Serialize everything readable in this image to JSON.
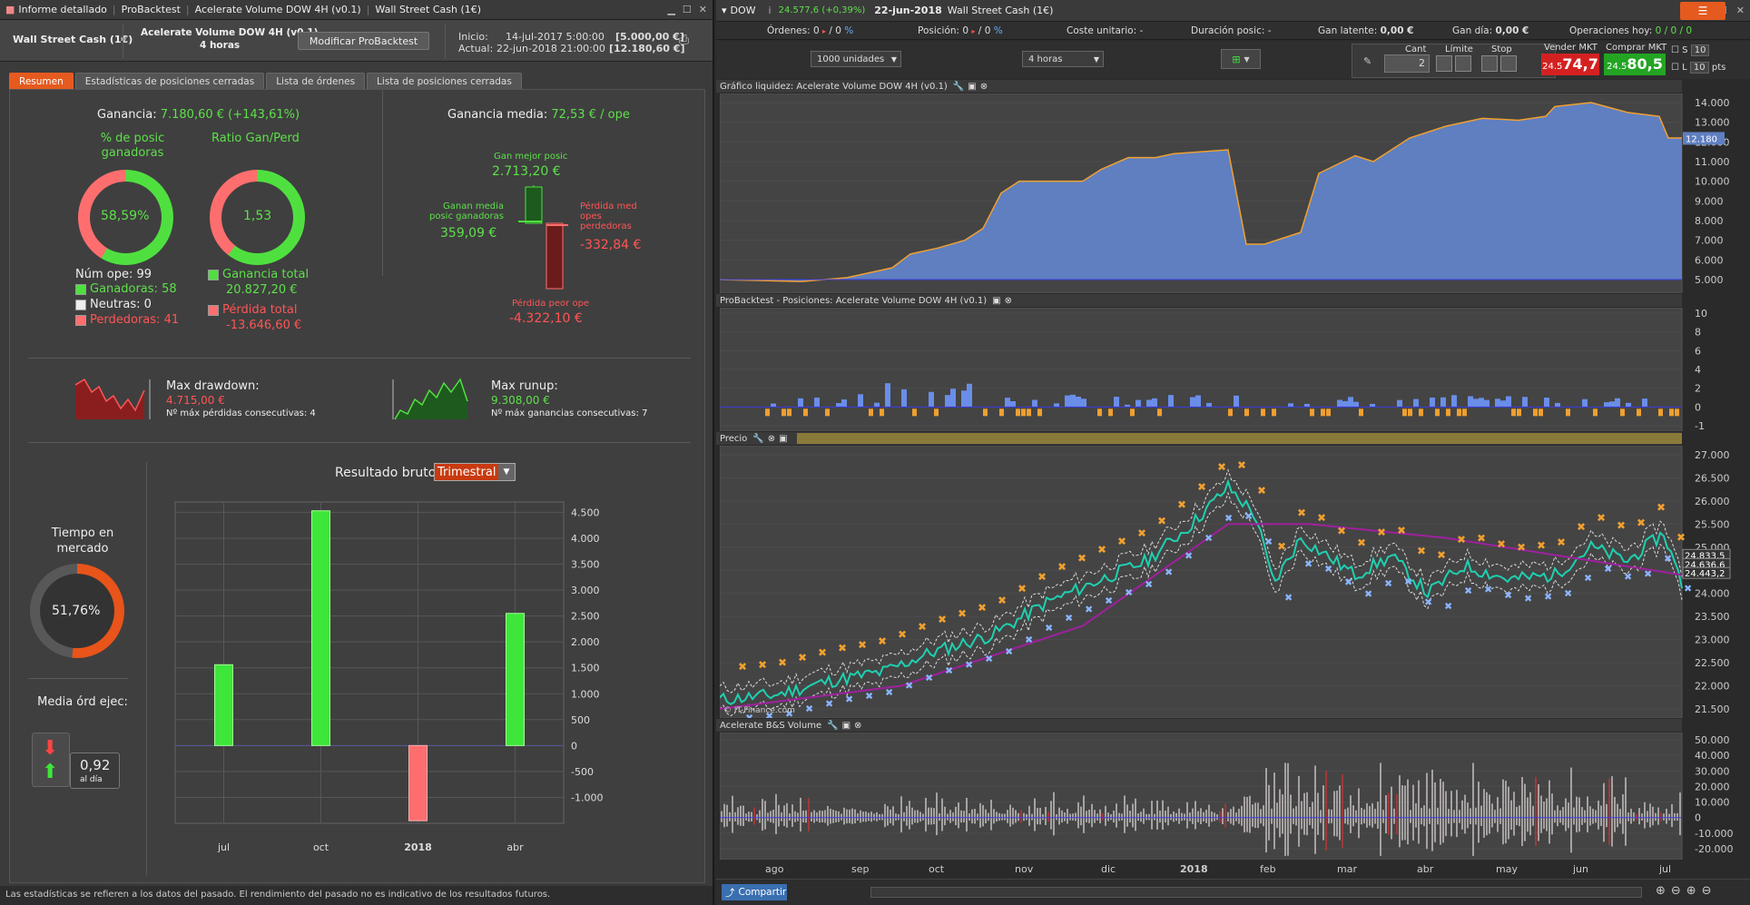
{
  "left_title": {
    "items": [
      "Informe detallado",
      "ProBacktest",
      "Acelerate Volume DOW 4H (v0.1)",
      "Wall Street Cash (1€)"
    ]
  },
  "header": {
    "instrument": "Wall Street Cash (1€)",
    "strategy": "Acelerate Volume DOW 4H (v0.1)",
    "timeframe": "4 horas",
    "modify_button": "Modificar ProBacktest",
    "start_label": "Inicio:",
    "start_date": "14-jul-2017 5:00:00",
    "start_capital": "[5.000,00 €]",
    "end_label": "Actual:",
    "end_date": "22-jun-2018 21:00:00",
    "end_capital": "[12.180,60 €]"
  },
  "tabs": [
    "Resumen",
    "Estadísticas de posiciones cerradas",
    "Lista de órdenes",
    "Lista de posiciones cerradas"
  ],
  "summary": {
    "gain_label": "Ganancia:",
    "gain_value": "7.180,60 € (+143,61%)",
    "winners_pct_label": "% de posic ganadoras",
    "winners_pct": "58,59%",
    "ratio_label": "Ratio Gan/Perd",
    "ratio": "1,53",
    "num_ops_label": "Núm ope:",
    "num_ops": "99",
    "winners_label": "Ganadoras:",
    "winners": "58",
    "neutral_label": "Neutras:",
    "neutral": "0",
    "losers_label": "Perdedoras:",
    "losers": "41",
    "total_gain_label": "Ganancia total",
    "total_gain": "20.827,20 €",
    "total_loss_label": "Pérdida total",
    "total_loss": "-13.646,60 €",
    "avg_gain_label": "Ganancia media:",
    "avg_gain": "72,53 € / ope",
    "best_label": "Gan mejor posic",
    "best": "2.713,20 €",
    "avg_win_label": "Ganan media posic ganadoras",
    "avg_win": "359,09 €",
    "avg_loss_label": "Pérdida med opes perdedoras",
    "avg_loss": "-332,84 €",
    "worst_label": "Pérdida peor ope",
    "worst": "-4.322,10 €",
    "dd_label": "Max drawdown:",
    "dd_value": "4.715,00 €",
    "dd_note": "Nº máx pérdidas consecutivas: 4",
    "ru_label": "Max runup:",
    "ru_value": "9.308,00 €",
    "ru_note": "Nº máx ganancias consecutivas: 7",
    "time_label": "Tiempo en mercado",
    "time_value": "51,76%",
    "avg_orders_label": "Media órd ejec:",
    "avg_orders": "0,92",
    "avg_orders_unit": "al día",
    "result_label": "Resultado bruto",
    "result_period": "Trimestral"
  },
  "chart_data": {
    "type": "bar",
    "categories": [
      "jul",
      "oct",
      "2018",
      "abr"
    ],
    "values": [
      1560,
      4530,
      -1450,
      2550
    ],
    "ylim": [
      -1500,
      4700
    ],
    "yticks": [
      "4.500",
      "4.000",
      "3.500",
      "3.000",
      "2.500",
      "2.000",
      "1.500",
      "1.000",
      "500",
      "0",
      "-500",
      "-1.000"
    ],
    "colors": {
      "positive": "#3ee63a",
      "negative": "#ff6e6e"
    }
  },
  "footer": "Las estadísticas se refieren a los datos del pasado. El rendimiento del pasado no es indicativo de los resultados futuros.",
  "right_title": {
    "symbol": "DOW",
    "price": "24.577,6 (+0,39%)",
    "date": "22-jun-2018",
    "instrument": "Wall Street Cash (1€)"
  },
  "position_bar": {
    "orders_label": "Órdenes:",
    "orders": "0",
    "orders_b": "0",
    "position_label": "Posición:",
    "position": "0",
    "position_b": "0",
    "unit_cost_label": "Coste unitario:",
    "unit_cost": "-",
    "duration_label": "Duración posic:",
    "duration": "-",
    "latent_label": "Gan latente:",
    "latent": "0,00 €",
    "day_label": "Gan día:",
    "day": "0,00 €",
    "today_label": "Operaciones hoy:",
    "today": "0 / 0 / 0"
  },
  "order_bar": {
    "units": "1000 unidades",
    "timeframe": "4 horas",
    "qty_label": "Cant",
    "qty": "2",
    "limit_label": "Límite",
    "stop_label": "Stop",
    "sell_label": "Vender MKT",
    "sell_big": "74,7",
    "sell_small": "24.5",
    "buy_label": "Comprar MKT",
    "buy_big": "80,5",
    "buy_small": "24.5",
    "s_label": "S",
    "l_label": "L",
    "pts": "10",
    "pts_label": "pts"
  },
  "equity_panel": {
    "title": "Gráfico liquidez: Acelerate Volume DOW 4H (v0.1)",
    "yticks": [
      "14.000",
      "13.000",
      "12.000",
      "11.000",
      "10.000",
      "9.000",
      "8.000",
      "7.000",
      "6.000",
      "5.000"
    ],
    "last": "12.180"
  },
  "positions_panel": {
    "title": "ProBacktest - Posiciones: Acelerate Volume DOW 4H (v0.1)",
    "yticks": [
      "10",
      "8",
      "6",
      "4",
      "2",
      "0",
      "-1"
    ]
  },
  "price_panel": {
    "title": "Precio",
    "yticks": [
      "27.000",
      "26.500",
      "26.000",
      "25.500",
      "25.000",
      "24.500",
      "24.000",
      "23.500",
      "23.000",
      "22.500",
      "22.000",
      "21.500"
    ],
    "labels": [
      "24.833,5",
      "24.636,6",
      "24.443,2"
    ],
    "copyright": "© IT-Finance.com"
  },
  "volume_panel": {
    "title": "Acelerate B&S Volume",
    "yticks": [
      "50.000",
      "40.000",
      "30.000",
      "20.000",
      "10.000",
      "0",
      "-10.000",
      "-20.000"
    ]
  },
  "xaxis": [
    "ago",
    "sep",
    "oct",
    "nov",
    "dic",
    "2018",
    "feb",
    "mar",
    "abr",
    "may",
    "jun",
    "jul"
  ],
  "bottom": {
    "share": "Compartir"
  }
}
